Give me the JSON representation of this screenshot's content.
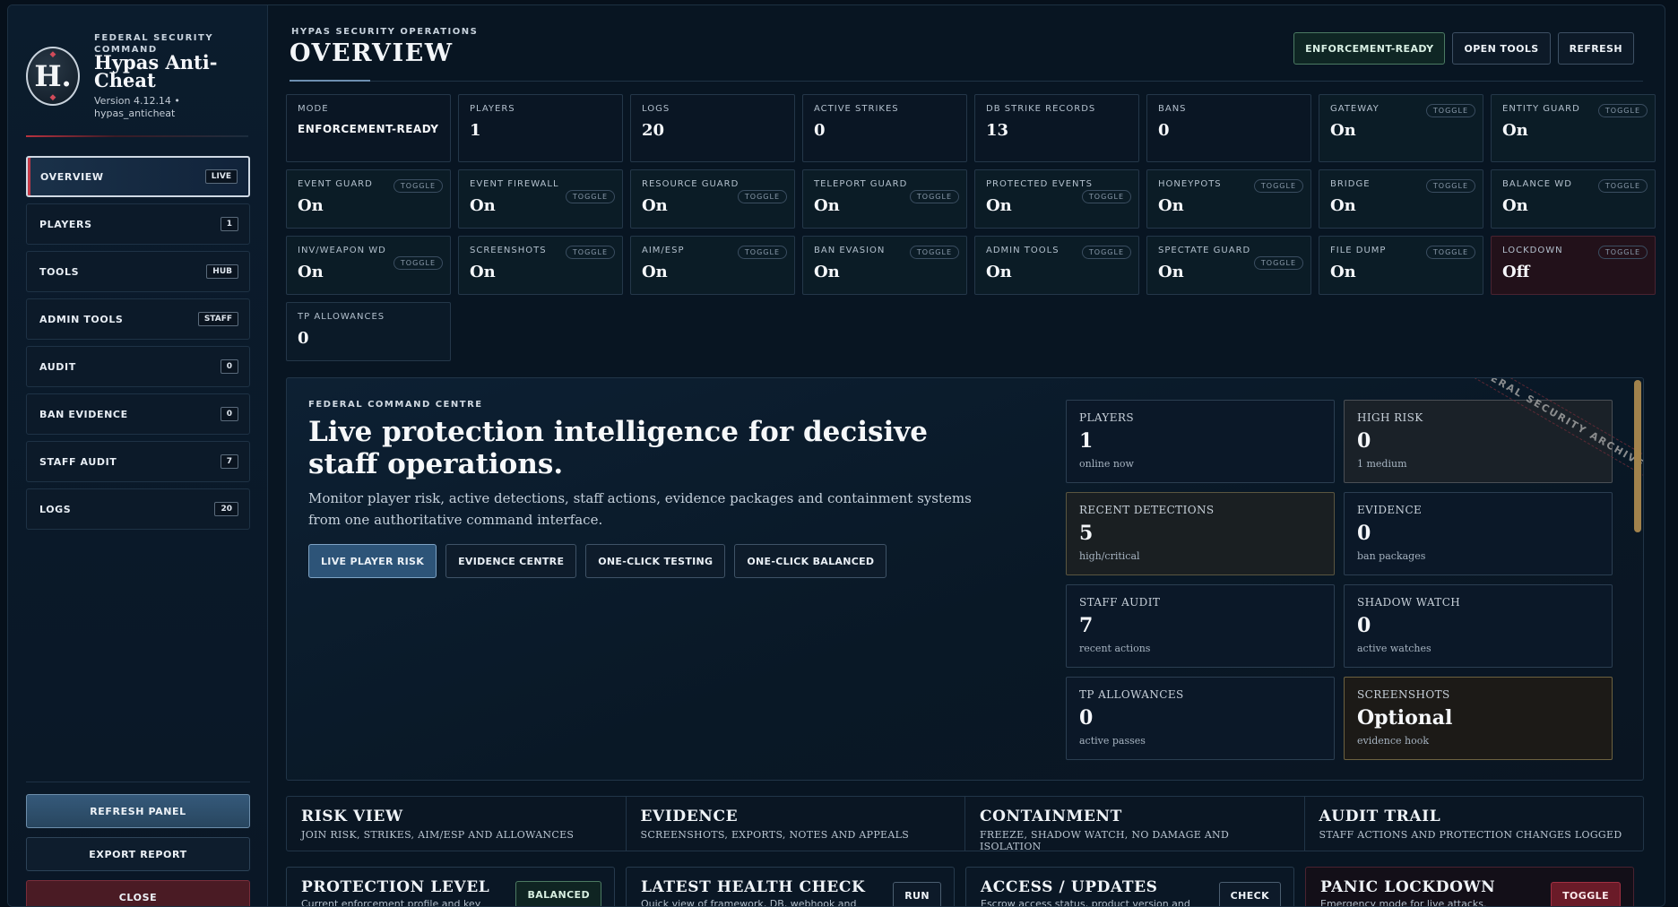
{
  "brand": {
    "kicker": "FEDERAL SECURITY COMMAND",
    "title": "Hypas Anti-Cheat",
    "version": "Version 4.12.14 • hypas_anticheat",
    "logo_letter": "H.",
    "logo_icon": "shield-h-icon"
  },
  "nav": [
    {
      "label": "OVERVIEW",
      "badge": "LIVE",
      "active": true
    },
    {
      "label": "PLAYERS",
      "badge": "1"
    },
    {
      "label": "TOOLS",
      "badge": "HUB"
    },
    {
      "label": "ADMIN TOOLS",
      "badge": "STAFF"
    },
    {
      "label": "AUDIT",
      "badge": "0"
    },
    {
      "label": "BAN EVIDENCE",
      "badge": "0"
    },
    {
      "label": "STAFF AUDIT",
      "badge": "7"
    },
    {
      "label": "LOGS",
      "badge": "20"
    }
  ],
  "sidebar_actions": {
    "refresh": "REFRESH PANEL",
    "export": "EXPORT REPORT",
    "close": "CLOSE"
  },
  "header": {
    "kicker": "HYPAS SECURITY OPERATIONS",
    "title": "OVERVIEW",
    "status_button": "ENFORCEMENT-READY",
    "open_tools": "OPEN TOOLS",
    "refresh": "REFRESH"
  },
  "toggle_label": "TOGGLE",
  "stats": [
    {
      "label": "MODE",
      "value": "ENFORCEMENT-READY"
    },
    {
      "label": "PLAYERS",
      "value": "1"
    },
    {
      "label": "LOGS",
      "value": "20"
    },
    {
      "label": "ACTIVE STRIKES",
      "value": "0"
    },
    {
      "label": "DB STRIKE RECORDS",
      "value": "13"
    },
    {
      "label": "BANS",
      "value": "0"
    },
    {
      "label": "GATEWAY",
      "value": "On",
      "toggle": true
    },
    {
      "label": "ENTITY GUARD",
      "value": "On",
      "toggle": true
    },
    {
      "label": "EVENT GUARD",
      "value": "On",
      "toggle": true
    },
    {
      "label": "EVENT FIREWALL",
      "value": "On",
      "toggle": true
    },
    {
      "label": "RESOURCE GUARD",
      "value": "On",
      "toggle": true
    },
    {
      "label": "TELEPORT GUARD",
      "value": "On",
      "toggle": true
    },
    {
      "label": "PROTECTED EVENTS",
      "value": "On",
      "toggle": true
    },
    {
      "label": "HONEYPOTS",
      "value": "On",
      "toggle": true
    },
    {
      "label": "BRIDGE",
      "value": "On",
      "toggle": true
    },
    {
      "label": "BALANCE WD",
      "value": "On",
      "toggle": true
    },
    {
      "label": "INV/WEAPON WD",
      "value": "On",
      "toggle": true
    },
    {
      "label": "SCREENSHOTS",
      "value": "On",
      "toggle": true
    },
    {
      "label": "AIM/ESP",
      "value": "On",
      "toggle": true
    },
    {
      "label": "BAN EVASION",
      "value": "On",
      "toggle": true
    },
    {
      "label": "ADMIN TOOLS",
      "value": "On",
      "toggle": true
    },
    {
      "label": "SPECTATE GUARD",
      "value": "On",
      "toggle": true
    },
    {
      "label": "FILE DUMP",
      "value": "On",
      "toggle": true
    },
    {
      "label": "LOCKDOWN",
      "value": "Off",
      "toggle": true
    },
    {
      "label": "TP ALLOWANCES",
      "value": "0"
    }
  ],
  "hero": {
    "kicker": "FEDERAL COMMAND CENTRE",
    "title": "Live protection intelligence for decisive staff operations.",
    "description": "Monitor player risk, active detections, staff actions, evidence packages and containment systems from one authoritative command interface.",
    "actions": [
      "LIVE PLAYER RISK",
      "EVIDENCE CENTRE",
      "ONE-CLICK TESTING",
      "ONE-CLICK BALANCED"
    ],
    "ribbon": "FEDERAL SECURITY ARCHIVE",
    "cards": [
      {
        "label": "PLAYERS",
        "value": "1",
        "sub": "online now"
      },
      {
        "label": "HIGH RISK",
        "value": "0",
        "sub": "1 medium"
      },
      {
        "label": "RECENT DETECTIONS",
        "value": "5",
        "sub": "high/critical"
      },
      {
        "label": "EVIDENCE",
        "value": "0",
        "sub": "ban packages"
      },
      {
        "label": "STAFF AUDIT",
        "value": "7",
        "sub": "recent actions"
      },
      {
        "label": "SHADOW WATCH",
        "value": "0",
        "sub": "active watches"
      },
      {
        "label": "TP ALLOWANCES",
        "value": "0",
        "sub": "active passes"
      },
      {
        "label": "SCREENSHOTS",
        "value": "Optional",
        "sub": "evidence hook"
      }
    ]
  },
  "sections": [
    {
      "title": "RISK VIEW",
      "sub": "JOIN RISK, STRIKES, AIM/ESP AND ALLOWANCES"
    },
    {
      "title": "EVIDENCE",
      "sub": "SCREENSHOTS, EXPORTS, NOTES AND APPEALS"
    },
    {
      "title": "CONTAINMENT",
      "sub": "FREEZE, SHADOW WATCH, NO DAMAGE AND ISOLATION"
    },
    {
      "title": "AUDIT TRAIL",
      "sub": "STAFF ACTIONS AND PROTECTION CHANGES LOGGED"
    }
  ],
  "panels": [
    {
      "title": "PROTECTION LEVEL",
      "desc": "Current enforcement profile and key",
      "button": "BALANCED"
    },
    {
      "title": "LATEST HEALTH CHECK",
      "desc": "Quick view of framework, DB, webhook and",
      "button": "RUN"
    },
    {
      "title": "ACCESS / UPDATES",
      "desc": "Escrow access status, product version and",
      "button": "CHECK"
    },
    {
      "title": "PANIC LOCKDOWN",
      "desc": "Emergency mode for live attacks.",
      "button": "TOGGLE"
    }
  ],
  "colors": {
    "background": "#06101b",
    "accent_blue": "#2d5478",
    "accent_red": "#c23a48",
    "ok_green": "#4b7a63",
    "gold": "#a1824c"
  }
}
